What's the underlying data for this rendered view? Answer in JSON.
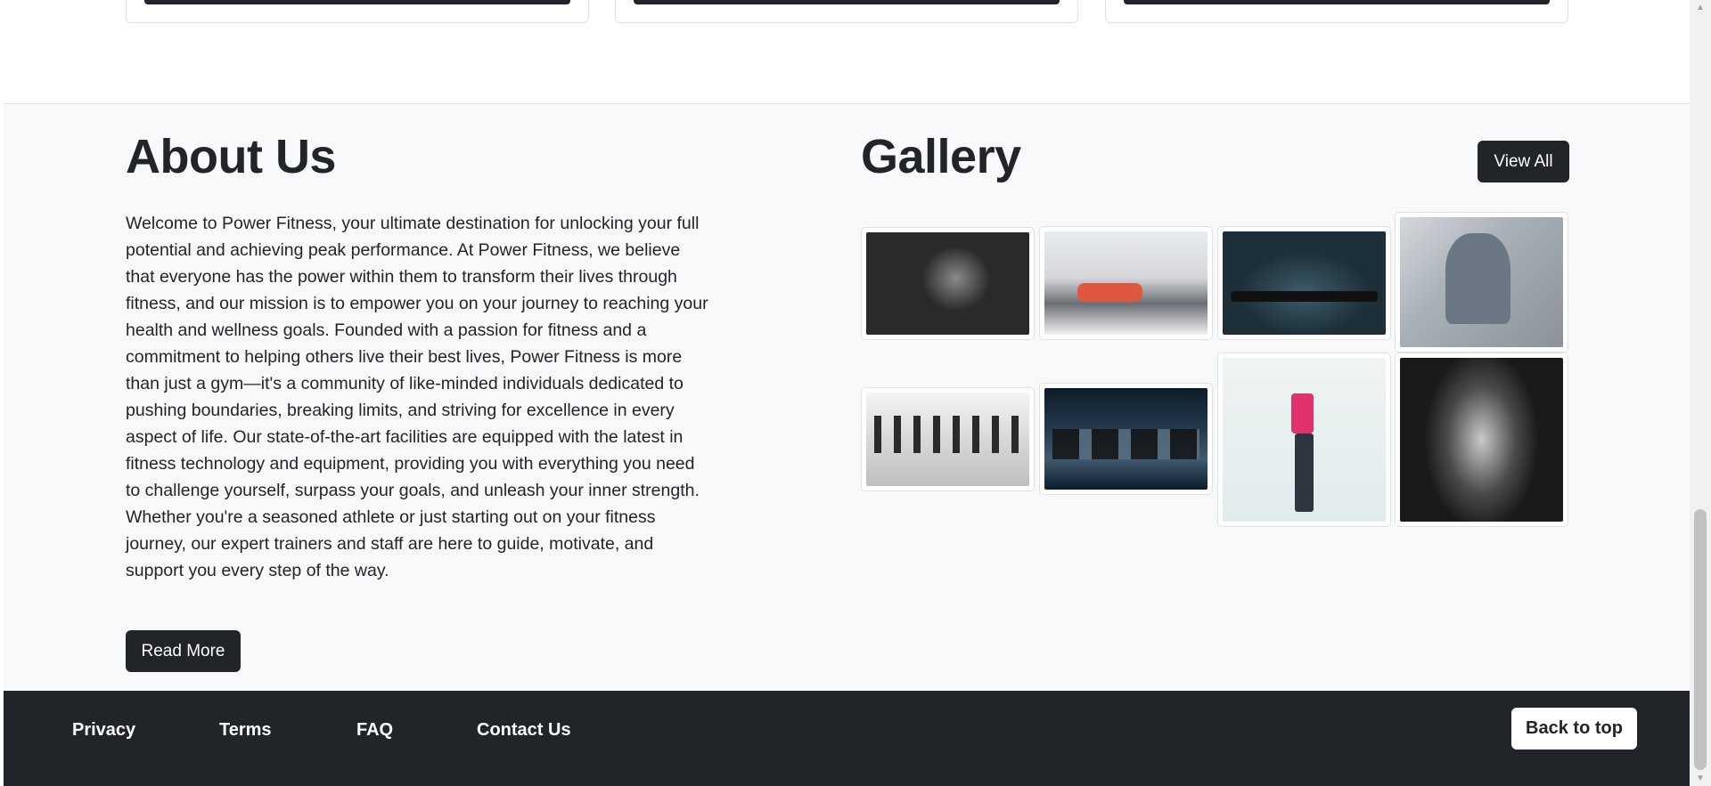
{
  "about": {
    "title": "About Us",
    "body": "Welcome to Power Fitness, your ultimate destination for unlocking your full potential and achieving peak performance. At Power Fitness, we believe that everyone has the power within them to transform their lives through fitness, and our mission is to empower you on your journey to reaching your health and wellness goals. Founded with a passion for fitness and a commitment to helping others live their best lives, Power Fitness is more than just a gym—it's a community of like-minded individuals dedicated to pushing boundaries, breaking limits, and striving for excellence in every aspect of life. Our state-of-the-art facilities are equipped with the latest in fitness technology and equipment, providing you with everything you need to challenge yourself, surpass your goals, and unleash your inner strength. Whether you're a seasoned athlete or just starting out on your fitness journey, our expert trainers and staff are here to guide, motivate, and support you every step of the way.",
    "read_more_label": "Read More"
  },
  "gallery": {
    "title": "Gallery",
    "view_all_label": "View All",
    "images": [
      {
        "name": "gallery-image-bodybuilder-dumbbells"
      },
      {
        "name": "gallery-image-gym-bench-press"
      },
      {
        "name": "gallery-image-barbell-lift"
      },
      {
        "name": "gallery-image-yoga-pose"
      },
      {
        "name": "gallery-image-weight-machines"
      },
      {
        "name": "gallery-image-treadmills"
      },
      {
        "name": "gallery-image-stretching-woman"
      },
      {
        "name": "gallery-image-flexing-bodybuilder"
      }
    ]
  },
  "footer": {
    "links": [
      "Privacy",
      "Terms",
      "FAQ",
      "Contact Us"
    ],
    "back_to_top_label": "Back to top"
  },
  "colors": {
    "dark": "#212529",
    "section_bg": "#f8f9fa",
    "border": "#dee2e6"
  }
}
